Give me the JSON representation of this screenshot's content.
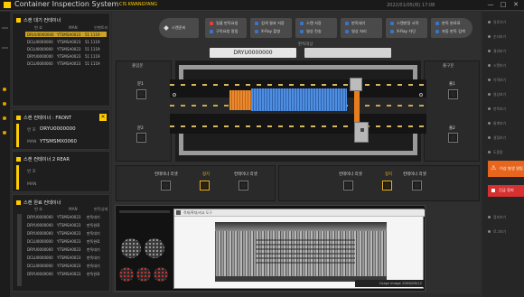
{
  "app": {
    "title": "Container Inspection System",
    "subtitle": "CIS KWANGYANG",
    "datetime": "2022/01/05(화) 17:08",
    "controls": [
      "—",
      "□",
      "✕"
    ]
  },
  "waiting": {
    "title": "스캔 대기 컨테이너",
    "headers": [
      "번 호",
      "MAN",
      "인벤토리"
    ],
    "rows": [
      [
        "DRUU0000000",
        "YTSMSA0023",
        "51 1119"
      ],
      [
        "DCLU0000000",
        "YTSMSA0023",
        "51 1119"
      ],
      [
        "DCLU0000000",
        "YTSMSA0023",
        "51 1119"
      ],
      [
        "DRYU0000000",
        "YTSMSA0023",
        "51 1119"
      ],
      [
        "DCLU0000000",
        "YTSMSA0023",
        "51 1119"
      ]
    ]
  },
  "front": {
    "title": "스캔 컨테이너 : FRONT",
    "no_label": "번 호",
    "no_value": "DRYU0000000",
    "man_label": "MAN",
    "man_value": "YTSMSMX0060"
  },
  "rear": {
    "title": "스캔 컨테이너 2 REAR",
    "no_label": "번 호",
    "man_label": "MAN"
  },
  "done": {
    "title": "스캔 완료 컨테이너",
    "headers": [
      "번 호",
      "MAN",
      "판독상태"
    ],
    "rows": [
      [
        "DRYU0000000",
        "YTSMSA0023",
        "판독대기"
      ],
      [
        "DRYU0000000",
        "YTSMSA0023",
        "판독완료"
      ],
      [
        "DRYU0000000",
        "YTSMSA0023",
        "판독대기"
      ],
      [
        "DCLU0000000",
        "YTSMSA0023",
        "판독완료"
      ],
      [
        "DRYU0000000",
        "YTSMSA0023",
        "판독대기"
      ],
      [
        "DCLU0000000",
        "YTSMSA0023",
        "판독대기"
      ],
      [
        "DCLU0000000",
        "YTSMSA0023",
        "판독대기"
      ],
      [
        "DRYU0000000",
        "YTSMSA0023",
        "판독완료"
      ]
    ]
  },
  "steps": {
    "start": "스캔준비",
    "items": [
      {
        "l1": "일괄 판독요청",
        "l2": "구독요청 알림",
        "c1": "#e04040",
        "c2": "#3b73c9"
      },
      {
        "l1": "검색 결과 저장",
        "l2": "X-Ray 촬영",
        "c1": "#3b73c9",
        "c2": "#3b73c9"
      },
      {
        "l1": "스캔 저장",
        "l2": "영상 전송",
        "c1": "#3b73c9",
        "c2": "#3b73c9"
      },
      {
        "l1": "판독대기",
        "l2": "영상 처리",
        "c1": "#3b73c9",
        "c2": "#3b73c9"
      },
      {
        "l1": "스캔판정 시작",
        "l2": "X-Ray 차단",
        "c1": "#3b73c9",
        "c2": "#3b73c9"
      },
      {
        "l1": "판독 완료료",
        "l2": "자동 판독 검색",
        "c1": "#3b73c9",
        "c2": "#3b73c9"
      }
    ]
  },
  "scan": {
    "title": "판독대상",
    "container_no": "DRYU0000000",
    "entrance": "출입문",
    "exit": "출구문",
    "left_btns": [
      "문1",
      "문2"
    ],
    "right_btns": [
      "출1",
      "출2"
    ],
    "controls_left": [
      "컨테이너 리셋",
      "정지",
      "컨테이너 리셋"
    ],
    "controls_right": [
      "컨테이너 리셋",
      "정지",
      "컨테이너 리셋"
    ]
  },
  "xray": {
    "caption": "Cargo image 2008/08/12",
    "toolbar": "적재/확대/비교 도구"
  },
  "right": {
    "items": [
      "뒤로가기",
      "순서보기",
      "결과보기",
      "스캔보기",
      "이력보기",
      "영상보기",
      "판독보기",
      "통계보기",
      "설정보기",
      "도움말",
      "정보보기",
      "로그보기"
    ],
    "alarm1": "이상 발생 알림",
    "alarm2": "긴급 정지"
  }
}
